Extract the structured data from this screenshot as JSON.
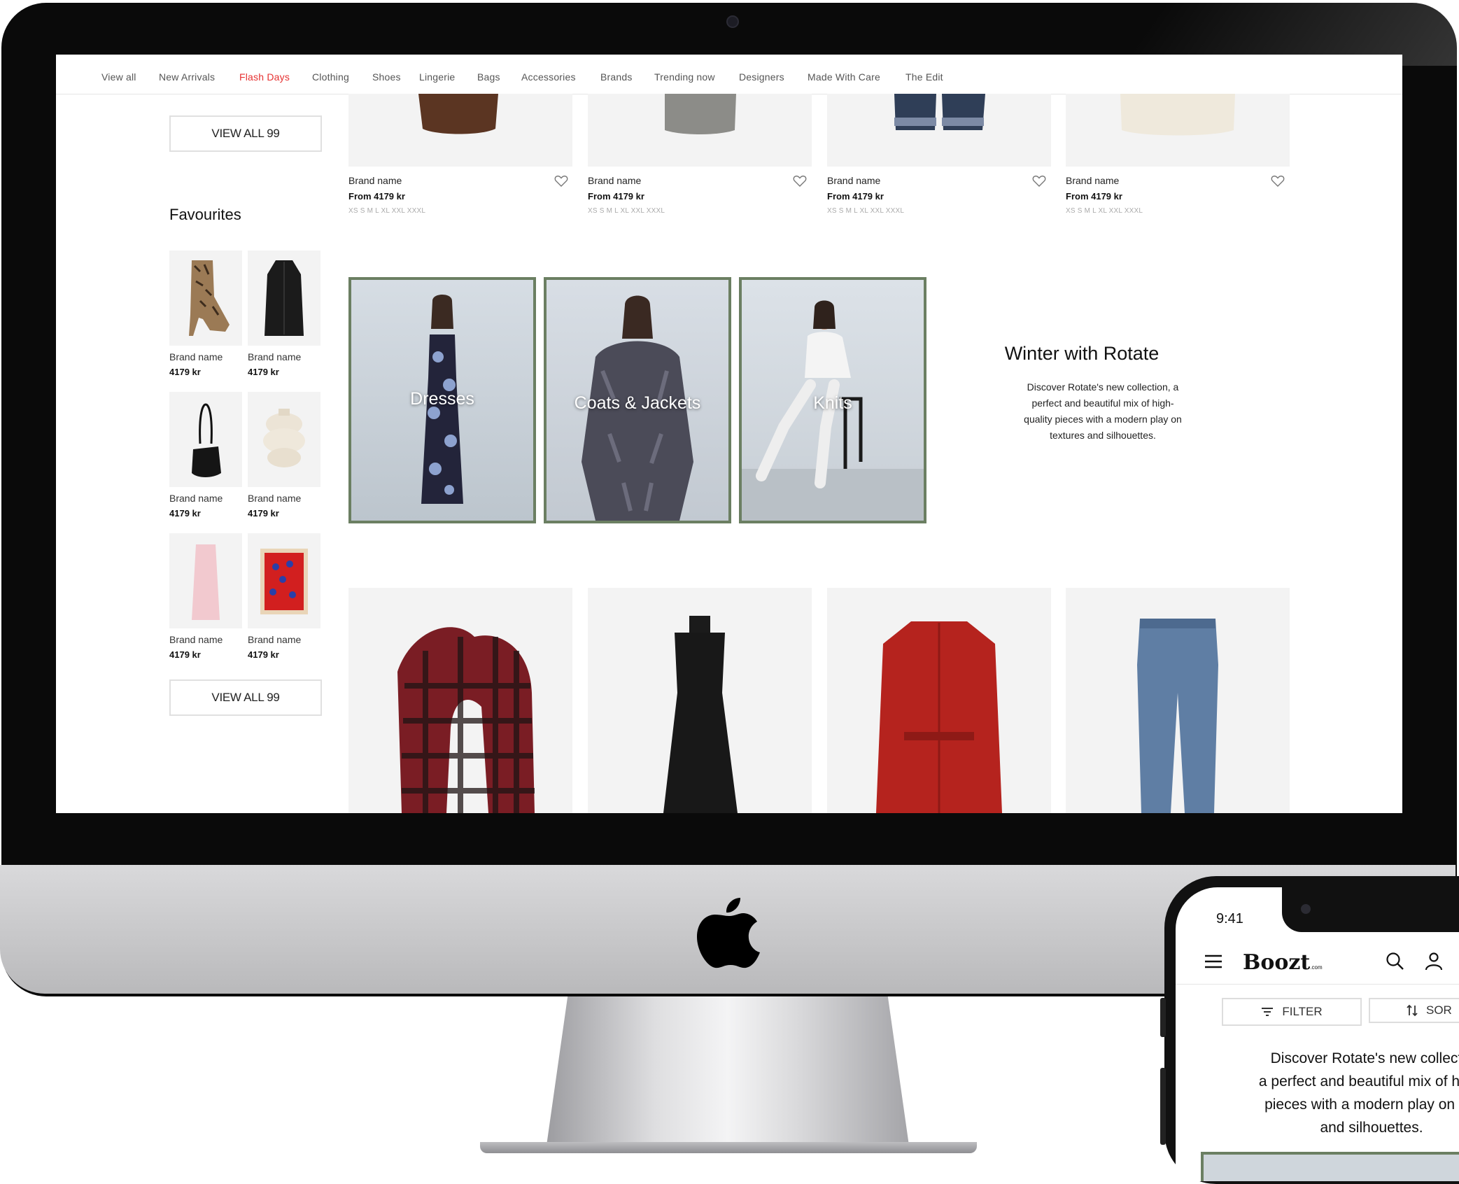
{
  "nav": {
    "items": [
      "View all",
      "New Arrivals",
      "Flash Days",
      "Clothing",
      "Shoes",
      "Lingerie",
      "Bags",
      "Accessories",
      "Brands",
      "Trending now",
      "Designers",
      "Made With Care",
      "The Edit"
    ],
    "active_index": 2,
    "active_color": "#e63131"
  },
  "sidebar": {
    "view_all_top": "VIEW ALL 99",
    "favourites_title": "Favourites",
    "favourites": [
      {
        "brand": "Brand name",
        "price": "4179 kr",
        "icon": "snakeskin-boot"
      },
      {
        "brand": "Brand name",
        "price": "4179 kr",
        "icon": "black-coat"
      },
      {
        "brand": "Brand name",
        "price": "4179 kr",
        "icon": "black-handbag"
      },
      {
        "brand": "Brand name",
        "price": "4179 kr",
        "icon": "cream-vase"
      },
      {
        "brand": "Brand name",
        "price": "4179 kr",
        "icon": "pink-skirt"
      },
      {
        "brand": "Brand name",
        "price": "4179 kr",
        "icon": "red-print"
      }
    ],
    "view_all_bottom": "VIEW ALL 99"
  },
  "products_top": [
    {
      "brand": "Brand name",
      "price": "From 4179 kr",
      "sizes": "XS S M L XL XXL XXXL",
      "icon": "brown-coat"
    },
    {
      "brand": "Brand name",
      "price": "From 4179 kr",
      "sizes": "XS S M L XL XXL XXXL",
      "icon": "grey-skirt"
    },
    {
      "brand": "Brand name",
      "price": "From 4179 kr",
      "sizes": "XS S M L XL XXL XXXL",
      "icon": "denim-jeans"
    },
    {
      "brand": "Brand name",
      "price": "From 4179 kr",
      "sizes": "XS S M L XL XXL XXXL",
      "icon": "cream-top"
    }
  ],
  "categories": [
    {
      "label": "Dresses"
    },
    {
      "label": "Coats & Jackets"
    },
    {
      "label": "Knits"
    }
  ],
  "promo": {
    "title": "Winter with Rotate",
    "text": "Discover Rotate's new collection, a perfect and beautiful mix of high-quality pieces with a modern play on textures and silhouettes."
  },
  "products_bottom": [
    {
      "icon": "plaid-scarf"
    },
    {
      "icon": "black-dress"
    },
    {
      "icon": "red-leather-coat"
    },
    {
      "icon": "blue-jeans"
    }
  ],
  "phone": {
    "time": "9:41",
    "logo": "Boozt",
    "logo_suffix": ".com",
    "filter_label": "FILTER",
    "sort_label": "SOR",
    "promo_lines": [
      "Discover Rotate's new collectic",
      "a perfect and beautiful mix of high-",
      "pieces with a modern play on tex",
      "and silhouettes."
    ]
  },
  "colors": {
    "tile_border": "#6b7f62",
    "accent": "#e63131"
  }
}
